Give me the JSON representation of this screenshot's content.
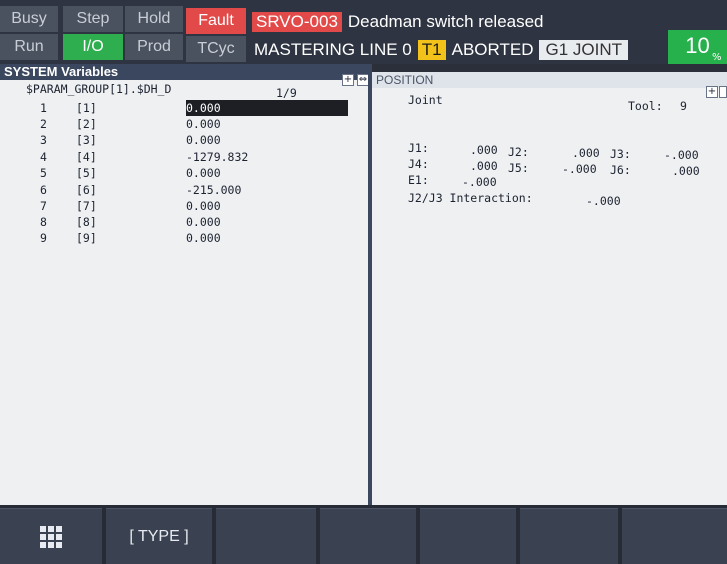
{
  "status": {
    "busy": "Busy",
    "step": "Step",
    "hold": "Hold",
    "fault": "Fault",
    "run": "Run",
    "io": "I/O",
    "prod": "Prod",
    "tcyc": "TCyc"
  },
  "alarm": {
    "code": "SRVO-003",
    "message": "Deadman switch released",
    "program": "MASTERING LINE 0",
    "task": "T1",
    "state": "ABORTED",
    "coord": "G1 JOINT"
  },
  "override": {
    "value": "10",
    "unit": "%"
  },
  "colors": {
    "fault": "#e24a4a",
    "io_active": "#2fae4f",
    "task_tag": "#f2c21b",
    "override": "#27b14c"
  },
  "sysvars": {
    "title": "SYSTEM Variables",
    "path": "$PARAM_GROUP[1].$DH_D",
    "page": "1/9",
    "rows": [
      {
        "num": "1",
        "index": "[1]",
        "value": "0.000"
      },
      {
        "num": "2",
        "index": "[2]",
        "value": "0.000"
      },
      {
        "num": "3",
        "index": "[3]",
        "value": "0.000"
      },
      {
        "num": "4",
        "index": "[4]",
        "value": "-1279.832"
      },
      {
        "num": "5",
        "index": "[5]",
        "value": "0.000"
      },
      {
        "num": "6",
        "index": "[6]",
        "value": "-215.000"
      },
      {
        "num": "7",
        "index": "[7]",
        "value": "0.000"
      },
      {
        "num": "8",
        "index": "[8]",
        "value": "0.000"
      },
      {
        "num": "9",
        "index": "[9]",
        "value": "0.000"
      }
    ]
  },
  "position": {
    "title": "POSITION",
    "mode": "Joint",
    "tool_label": "Tool:",
    "tool": "9",
    "j1_label": "J1:",
    "j1": ".000",
    "j2_label": "J2:",
    "j2": ".000",
    "j3_label": "J3:",
    "j3": "-.000",
    "j4_label": "J4:",
    "j4": ".000",
    "j5_label": "J5:",
    "j5": "-.000",
    "j6_label": "J6:",
    "j6": ".000",
    "e1_label": "E1:",
    "e1": "-.000",
    "interaction_label": "J2/J3 Interaction:",
    "interaction": "-.000"
  },
  "fkeys": {
    "f1": "[ TYPE ]"
  }
}
